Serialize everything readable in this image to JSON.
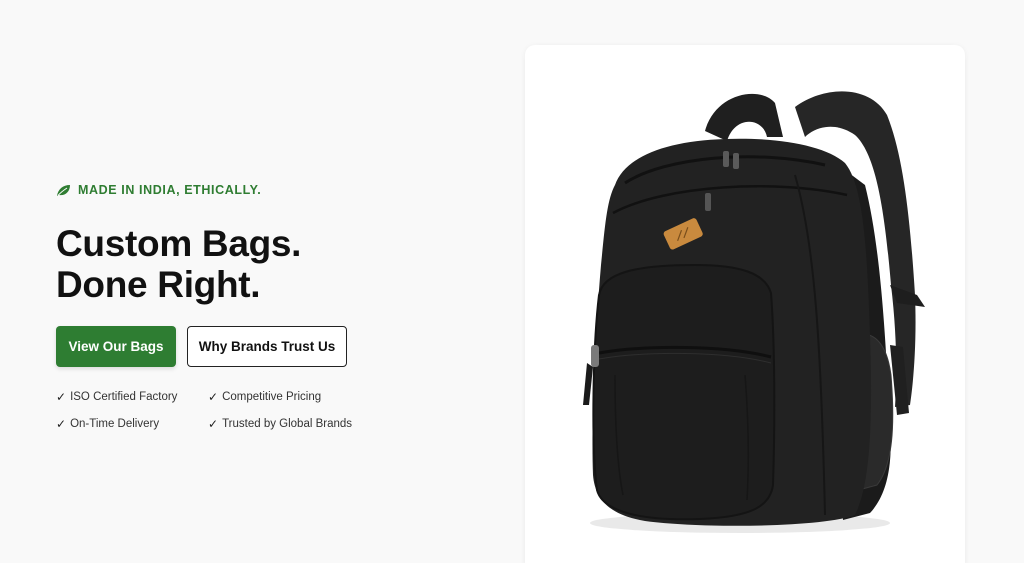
{
  "hero": {
    "tagline": "MADE IN INDIA, ETHICALLY.",
    "tagline_icon": "leaf-icon",
    "headline_line1": "Custom Bags.",
    "headline_line2": "Done Right.",
    "primary_button": "View Our Bags",
    "secondary_button": "Why Brands Trust Us",
    "features": [
      "ISO Certified Factory",
      "Competitive Pricing",
      "On-Time Delivery",
      "Trusted by Global Brands"
    ],
    "check_mark": "✓"
  },
  "product_image": {
    "subject": "black backpack"
  },
  "colors": {
    "accent": "#2e7d32",
    "background": "#f9f9f9",
    "card": "#ffffff"
  }
}
